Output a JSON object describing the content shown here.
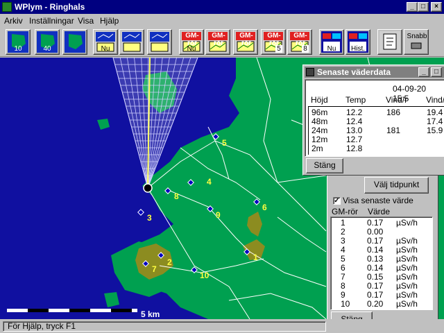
{
  "window": {
    "title": "WPlym - Ringhals",
    "min": "_",
    "max": "□",
    "close": "×"
  },
  "menu": [
    "Arkiv",
    "Inställningar",
    "Visa",
    "Hjälp"
  ],
  "toolbar": {
    "buttons": [
      {
        "name": "map-10-button",
        "label": "10",
        "kind": "map"
      },
      {
        "name": "map-40-button",
        "label": "40",
        "kind": "map"
      },
      {
        "name": "map-site-button",
        "label": "",
        "kind": "map"
      },
      {
        "name": "weather-now-button",
        "label": "Nu",
        "kind": "wx"
      },
      {
        "name": "weather-table-button",
        "label": "",
        "kind": "wx"
      },
      {
        "name": "weather-graph-button",
        "label": "",
        "kind": "wx"
      },
      {
        "name": "gm-now-button",
        "label": "Nu",
        "kind": "gm",
        "caption": "GM-rör"
      },
      {
        "name": "gm-table-button",
        "label": "",
        "kind": "gm",
        "caption": "GM-rör"
      },
      {
        "name": "gm-graph-button",
        "label": "",
        "kind": "gm",
        "caption": "GM-rör"
      },
      {
        "name": "gm-graph-5-button",
        "label": "5",
        "kind": "gm",
        "caption": "GM-rör"
      },
      {
        "name": "gm-graph-8-button",
        "label": "8",
        "kind": "gm",
        "caption": "GM-rör"
      },
      {
        "name": "combined-now-button",
        "label": "Nu",
        "kind": "combo"
      },
      {
        "name": "combined-history-button",
        "label": "Hist.",
        "kind": "combo"
      },
      {
        "name": "notes-button",
        "label": "",
        "kind": "note"
      },
      {
        "name": "snabb-button",
        "label": "Snabb",
        "kind": "snabb"
      }
    ]
  },
  "map": {
    "scale_label": "5 km",
    "stations": [
      {
        "id": "1",
        "label": "1"
      },
      {
        "id": "2",
        "label": "2"
      },
      {
        "id": "3",
        "label": "3"
      },
      {
        "id": "4",
        "label": "4"
      },
      {
        "id": "5",
        "label": "5"
      },
      {
        "id": "6",
        "label": "6"
      },
      {
        "id": "7",
        "label": "7"
      },
      {
        "id": "8",
        "label": "8"
      },
      {
        "id": "9",
        "label": "9"
      },
      {
        "id": "10",
        "label": "10"
      }
    ],
    "colors": {
      "sea": "#1010a0",
      "land": "#00a050",
      "urban": "#8c8c20",
      "plume": "#ffff60",
      "station": "#0000c0",
      "label": "#ffff40"
    }
  },
  "weather": {
    "title": "Senaste väderdata",
    "date": "04-09-20 15:5",
    "headers": [
      "Höjd",
      "Temp",
      "Vind/r",
      "Vind/"
    ],
    "rows": [
      {
        "h": "96m",
        "t": "12.2",
        "d": "186",
        "s": "19.4"
      },
      {
        "h": "48m",
        "t": "12.4",
        "d": "",
        "s": "17.4"
      },
      {
        "h": "24m",
        "t": "13.0",
        "d": "181",
        "s": "15.9"
      },
      {
        "h": "12m",
        "t": "12.7",
        "d": "",
        "s": ""
      },
      {
        "h": "2m",
        "t": "12.8",
        "d": "",
        "s": ""
      }
    ],
    "close_label": "Stäng"
  },
  "gm": {
    "select_time_label": "Välj tidpunkt",
    "show_latest_label": "Visa senaste värde",
    "show_latest_checked": true,
    "col_tube": "GM-rör",
    "col_value": "Värde",
    "rows": [
      {
        "n": "1",
        "v": "0.17",
        "u": "µSv/h"
      },
      {
        "n": "2",
        "v": "0.00",
        "u": ""
      },
      {
        "n": "3",
        "v": "0.17",
        "u": "µSv/h"
      },
      {
        "n": "4",
        "v": "0.14",
        "u": "µSv/h"
      },
      {
        "n": "5",
        "v": "0.13",
        "u": "µSv/h"
      },
      {
        "n": "6",
        "v": "0.14",
        "u": "µSv/h"
      },
      {
        "n": "7",
        "v": "0.15",
        "u": "µSv/h"
      },
      {
        "n": "8",
        "v": "0.17",
        "u": "µSv/h"
      },
      {
        "n": "9",
        "v": "0.17",
        "u": "µSv/h"
      },
      {
        "n": "10",
        "v": "0.20",
        "u": "µSv/h"
      }
    ],
    "close_label": "Stäng"
  },
  "status": {
    "text": "För Hjälp, tryck F1"
  }
}
